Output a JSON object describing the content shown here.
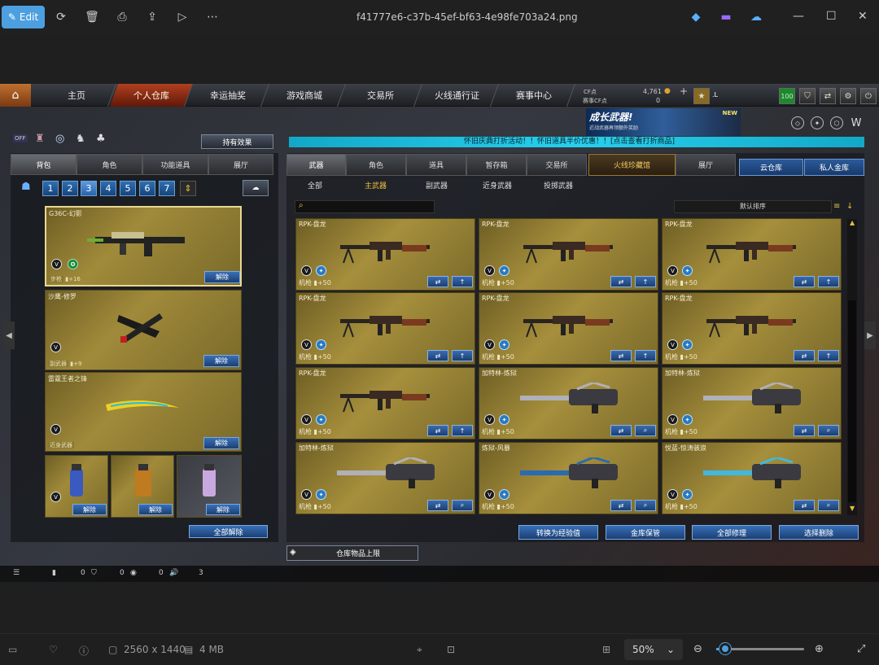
{
  "viewer": {
    "edit_label": "Edit",
    "file_name": "f41777e6-c37b-45ef-bf63-4e98fe703a24.png",
    "resolution": "2560 x 1440",
    "file_size": "4 MB",
    "zoom": "50%"
  },
  "game": {
    "nav": [
      "主页",
      "个人仓库",
      "幸运抽奖",
      "游戏商城",
      "交易所",
      "火线通行证",
      "赛事中心"
    ],
    "cf_label": "CF点",
    "cf_value": "4,761",
    "match_cf_label": "赛事CF点",
    "match_cf_value": "0",
    "user_level": "100",
    "player_tag": ".L",
    "banner_title": "成长武器!",
    "banner_sub": "近战武器再领额外奖励",
    "banner_badge": "NEW",
    "ticker": "怀旧庆典打折活动！！怀旧道具半价优惠！！[点击查看打折商品]",
    "off_label": "OFF",
    "effect_button": "持有效果",
    "left_tabs": [
      "背包",
      "角色",
      "功能道具",
      "展厅"
    ],
    "pages": [
      "1",
      "2",
      "3",
      "4",
      "5",
      "6",
      "7"
    ],
    "active_page": "3",
    "equipped": [
      {
        "name": "G36C-幻影",
        "type": "步枪",
        "bonus": "+16",
        "action": "解除"
      },
      {
        "name": "沙鹰-修罗",
        "type": "副武器",
        "bonus": "+9",
        "action": "解除"
      },
      {
        "name": "雷霆王者之锋",
        "type": "近身武器",
        "action": "解除"
      }
    ],
    "grenade_action": "解除",
    "release_all": "全部解除",
    "right_tabs": [
      "武器",
      "角色",
      "道具",
      "暂存箱",
      "交易所",
      "火线珍藏馆",
      "展厅"
    ],
    "cloud_tab": "云仓库",
    "private_tab": "私人金库",
    "sub_tabs": [
      "全部",
      "主武器",
      "副武器",
      "近身武器",
      "投掷武器"
    ],
    "sort_label": "默认排序",
    "cards": [
      {
        "name": "RPK-盘龙",
        "type": "机枪",
        "bonus": "+50",
        "kind": "rpk"
      },
      {
        "name": "RPK-盘龙",
        "type": "机枪",
        "bonus": "+50",
        "kind": "rpk"
      },
      {
        "name": "RPK-盘龙",
        "type": "机枪",
        "bonus": "+50",
        "kind": "rpk"
      },
      {
        "name": "RPK-盘龙",
        "type": "机枪",
        "bonus": "+50",
        "kind": "rpk"
      },
      {
        "name": "RPK-盘龙",
        "type": "机枪",
        "bonus": "+50",
        "kind": "rpk"
      },
      {
        "name": "RPK-盘龙",
        "type": "机枪",
        "bonus": "+50",
        "kind": "rpk"
      },
      {
        "name": "RPK-盘龙",
        "type": "机枪",
        "bonus": "+50",
        "kind": "rpk"
      },
      {
        "name": "加特林-炼狱",
        "type": "机枪",
        "bonus": "+50",
        "kind": "gat"
      },
      {
        "name": "加特林-炼狱",
        "type": "机枪",
        "bonus": "+50",
        "kind": "gat"
      },
      {
        "name": "加特林-炼狱",
        "type": "机枪",
        "bonus": "+50",
        "kind": "gat"
      },
      {
        "name": "炼狱-风暴",
        "type": "机枪",
        "bonus": "+50",
        "kind": "gat2"
      },
      {
        "name": "悦蓝-惊涛骇浪",
        "type": "机枪",
        "bonus": "+50",
        "kind": "gat3"
      }
    ],
    "bottom_buttons": [
      "转换为经验值",
      "金库保管",
      "全部修理",
      "选择删除"
    ],
    "storage_limit": "仓库物品上限",
    "status": {
      "a": "0",
      "b": "0",
      "c": "0",
      "d": "3"
    }
  }
}
